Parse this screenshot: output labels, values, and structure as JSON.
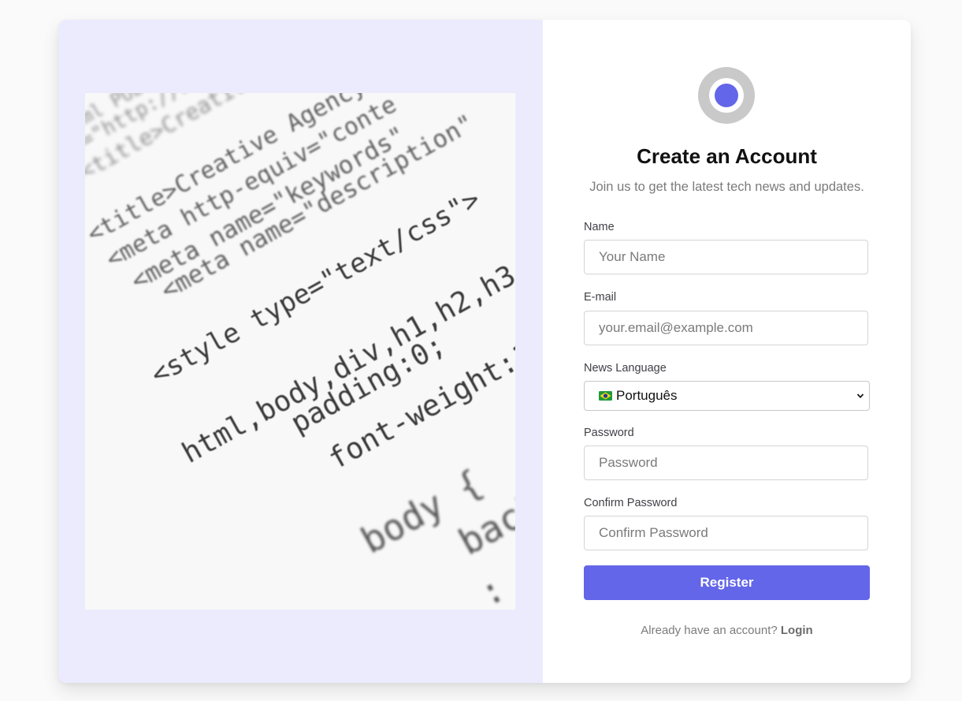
{
  "form": {
    "title": "Create an Account",
    "subtitle": "Join us to get the latest tech news and updates.",
    "name_label": "Name",
    "name_placeholder": "Your Name",
    "email_label": "E-mail",
    "email_placeholder": "your.email@example.com",
    "language_label": "News Language",
    "language_selected": "Português",
    "language_flag": "brazil-flag-icon",
    "password_label": "Password",
    "password_placeholder": "Password",
    "confirm_label": "Confirm Password",
    "confirm_placeholder": "Confirm Password",
    "register_label": "Register",
    "footer_text": "Already have an account?",
    "login_link": "Login"
  },
  "colors": {
    "accent": "#6366e8",
    "left_panel_bg": "#ecebfd",
    "logo_ring": "#c9c9c9"
  }
}
